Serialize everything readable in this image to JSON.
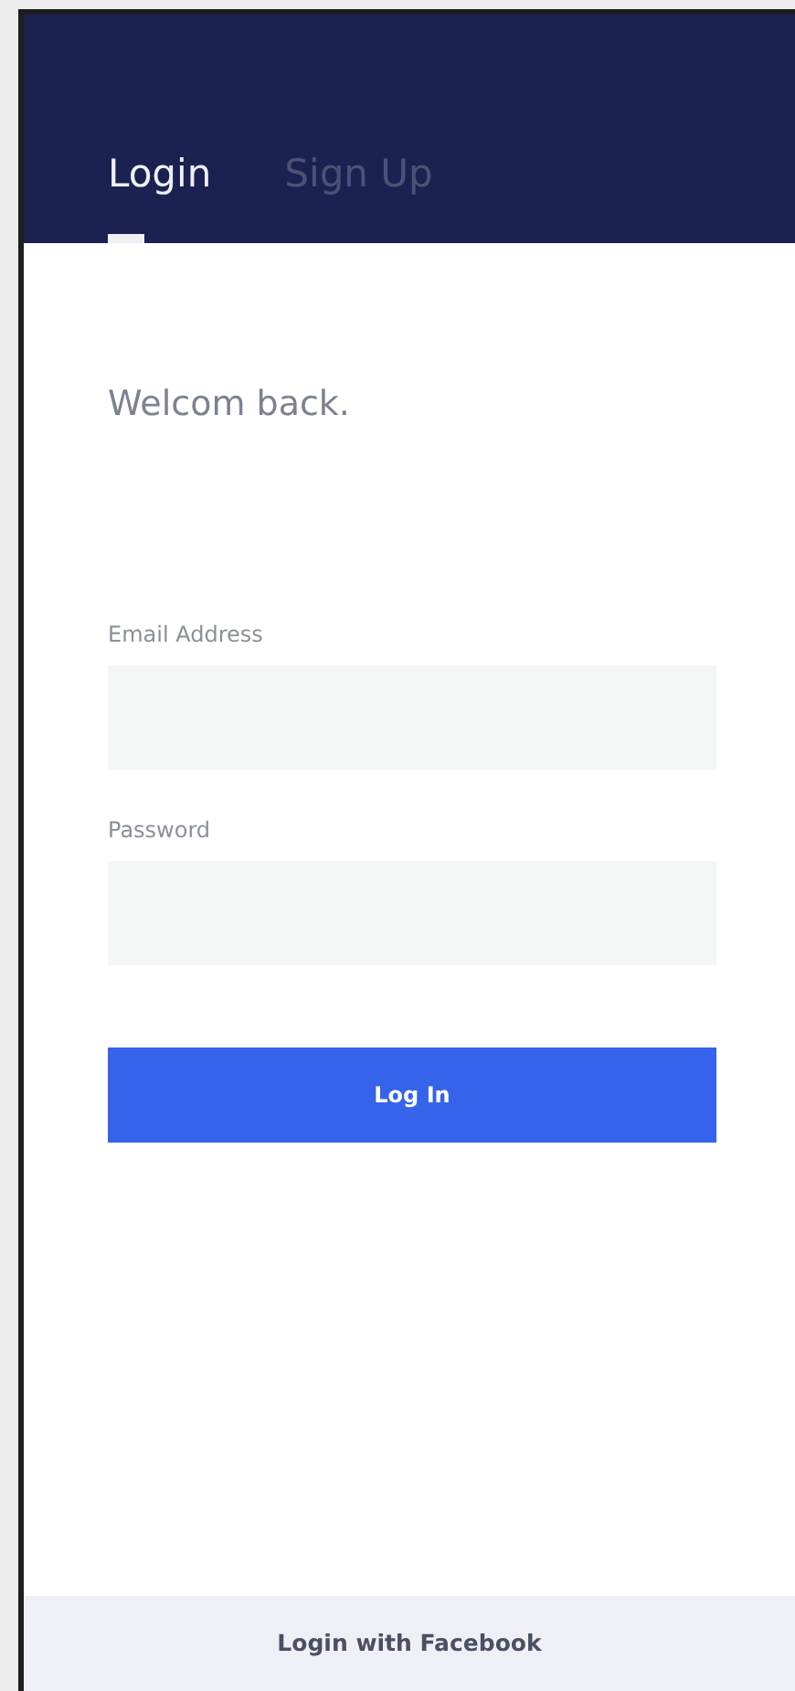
{
  "tabs": [
    {
      "label": "Login",
      "selected": true
    },
    {
      "label": "Sign Up",
      "selected": false
    }
  ],
  "greeting": "Welcom back.",
  "fields": [
    {
      "label": "Email Address"
    },
    {
      "label": "Password"
    }
  ],
  "submit_button": "Log In",
  "footer_link": "Login with Facebook"
}
